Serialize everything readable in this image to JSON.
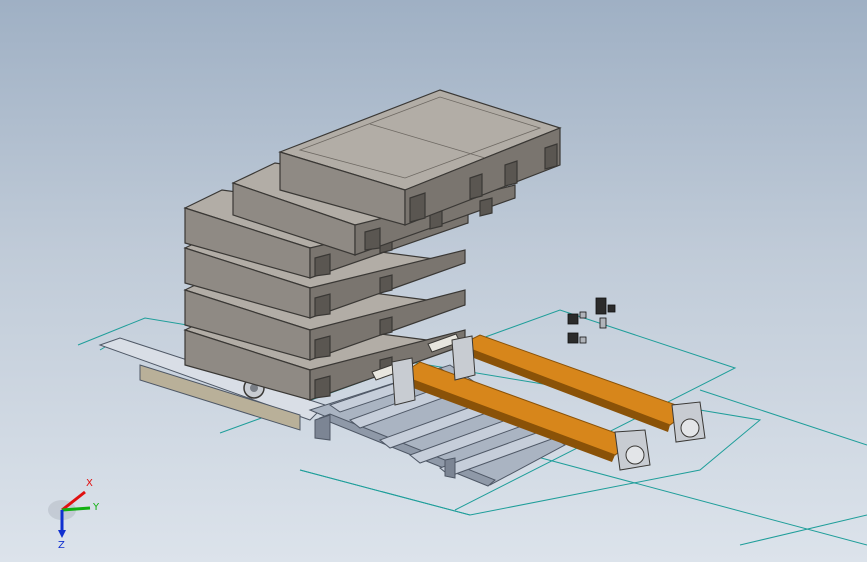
{
  "viewport": {
    "background_top": "#9fb0c4",
    "background_bottom": "#dce3eb"
  },
  "colors": {
    "pallet_face": "#8f8a84",
    "pallet_top": "#b2ada6",
    "pallet_edge": "#3a3835",
    "cylinder": "#d7861b",
    "cylinder_dark": "#8a5208",
    "frame": "#aab4c2",
    "frame_dark": "#4f5866",
    "sketch_lines": "#1f9e9a"
  },
  "triad": {
    "x_label": "X",
    "y_label": "Y",
    "z_label": "Z",
    "x_color": "#e01010",
    "y_color": "#10b010",
    "z_color": "#1030d0"
  }
}
